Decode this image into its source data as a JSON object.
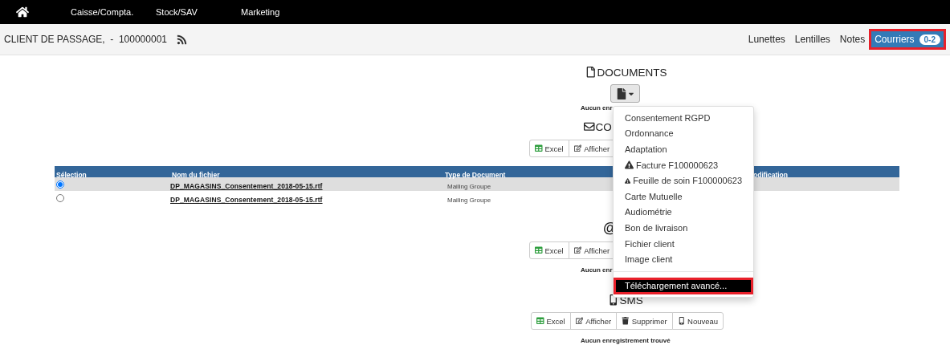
{
  "nav": {
    "items": [
      {
        "label": "Caisse/Compta."
      },
      {
        "label": "Stock/SAV"
      },
      {
        "label": "Marketing"
      }
    ]
  },
  "header": {
    "client": "CLIENT DE PASSAGE,  -  100000001",
    "tabs": [
      {
        "label": "Lunettes",
        "selected": false
      },
      {
        "label": "Lentilles",
        "selected": false
      },
      {
        "label": "Notes",
        "selected": false
      },
      {
        "label": "Courriers",
        "badge": "0-2",
        "selected": true
      }
    ]
  },
  "sections": [
    {
      "kind": "documents",
      "title": "DOCUMENTS",
      "empty_text": "Aucun enr"
    },
    {
      "kind": "courriers",
      "title": "CO",
      "buttons": [
        {
          "kind": "excel",
          "label": "Excel"
        },
        {
          "kind": "edit",
          "label": "Afficher"
        }
      ],
      "table": {
        "columns": [
          "Sélection",
          "Nom du fichier",
          "Type de Document",
          "odification"
        ],
        "rows": [
          {
            "selected": true,
            "file": "DP_MAGASINS_Consentement_2018-05-15.rtf",
            "type": "Mailing Groupe"
          },
          {
            "selected": false,
            "file": "DP_MAGASINS_Consentement_2018-05-15.rtf",
            "type": "Mailing Groupe"
          }
        ]
      }
    },
    {
      "kind": "email",
      "title": "@",
      "buttons": [
        {
          "kind": "excel",
          "label": "Excel"
        },
        {
          "kind": "edit",
          "label": "Afficher"
        }
      ],
      "empty_text": "Aucun enr"
    },
    {
      "kind": "sms",
      "title": "SMS",
      "buttons": [
        {
          "kind": "excel",
          "label": "Excel"
        },
        {
          "kind": "edit",
          "label": "Afficher"
        },
        {
          "kind": "delete",
          "label": "Supprimer"
        },
        {
          "kind": "new",
          "label": "Nouveau"
        }
      ],
      "empty_text": "Aucun enregistrement trouvé"
    }
  ],
  "menu": {
    "items": [
      {
        "kind": "plain",
        "label": "Consentement RGPD",
        "selected": false
      },
      {
        "kind": "plain",
        "label": "Ordonnance",
        "selected": false
      },
      {
        "kind": "plain",
        "label": "Adaptation",
        "selected": false
      },
      {
        "kind": "warning",
        "label": "Facture F100000623",
        "selected": false
      },
      {
        "kind": "warning",
        "label": "Feuille de soin F100000623",
        "selected": false
      },
      {
        "kind": "plain",
        "label": "Carte Mutuelle",
        "selected": false
      },
      {
        "kind": "plain",
        "label": "Audiométrie",
        "selected": false
      },
      {
        "kind": "plain",
        "label": "Bon de livraison",
        "selected": false
      },
      {
        "kind": "plain",
        "label": "Fichier client",
        "selected": false
      },
      {
        "kind": "plain",
        "label": "Image client",
        "selected": false
      },
      {
        "kind": "divider"
      },
      {
        "kind": "plain",
        "label": "Téléchargement avancé...",
        "selected": true
      }
    ]
  }
}
